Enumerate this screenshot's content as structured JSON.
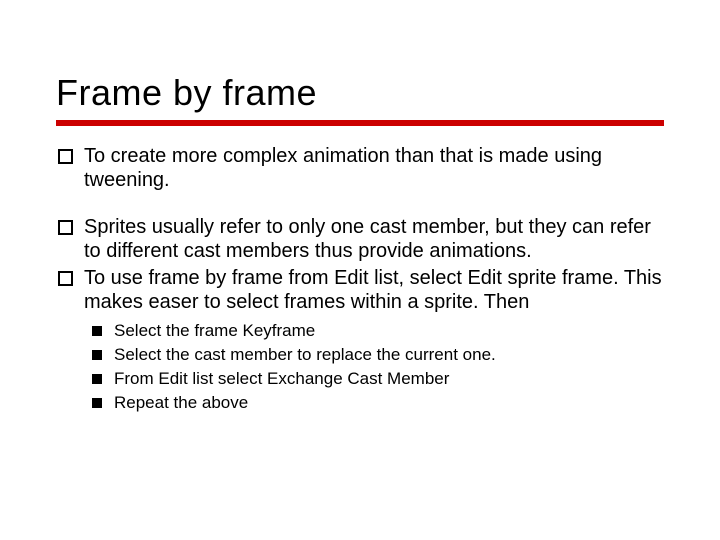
{
  "title": "Frame by frame",
  "bullets": [
    {
      "text": "To create more complex animation than that is made using tweening.",
      "tight": false
    },
    {
      "text": "Sprites usually refer to only one cast member, but they can refer to different cast members thus provide animations.",
      "tight": true
    },
    {
      "text": "To use frame by frame from Edit list, select Edit sprite frame. This makes easer to select frames within a sprite. Then",
      "tight": false
    }
  ],
  "subbullets": [
    " Select the frame Keyframe",
    " Select the cast member to replace the current one.",
    " From Edit list select Exchange Cast Member",
    " Repeat the above"
  ]
}
